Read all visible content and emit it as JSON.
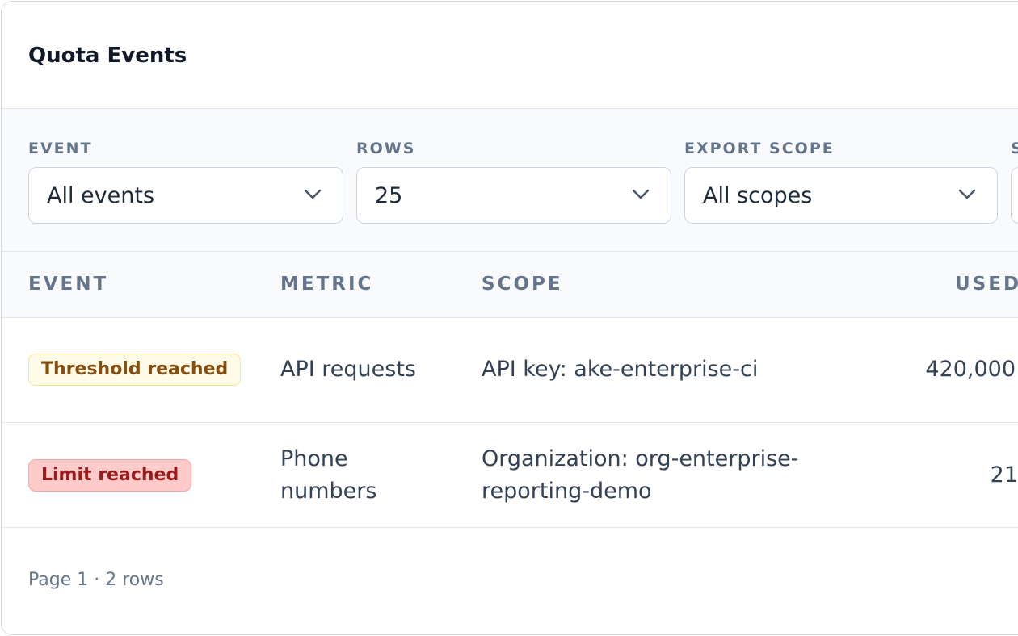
{
  "card": {
    "title": "Quota Events"
  },
  "filters": [
    {
      "label": "EVENT",
      "value": "All events"
    },
    {
      "label": "ROWS",
      "value": "25"
    },
    {
      "label": "EXPORT SCOPE",
      "value": "All scopes"
    },
    {
      "label": "S",
      "value": ""
    }
  ],
  "table": {
    "columns": [
      "EVENT",
      "METRIC",
      "SCOPE",
      "USED"
    ],
    "rows": [
      {
        "event": "Threshold reached",
        "metric": "API requests",
        "scope": "API key: ake-enterprise-ci",
        "used": "420,000"
      },
      {
        "event": "Limit reached",
        "metric": "Phone numbers",
        "scope": "Organization: org-enterprise-reporting-demo",
        "used": "21"
      }
    ]
  },
  "footer": {
    "text": "Page 1 · 2 rows"
  },
  "colors": {
    "warn_badge_bg": "#fefce8",
    "danger_badge_bg": "#fecaca",
    "muted_text": "#64748b"
  }
}
